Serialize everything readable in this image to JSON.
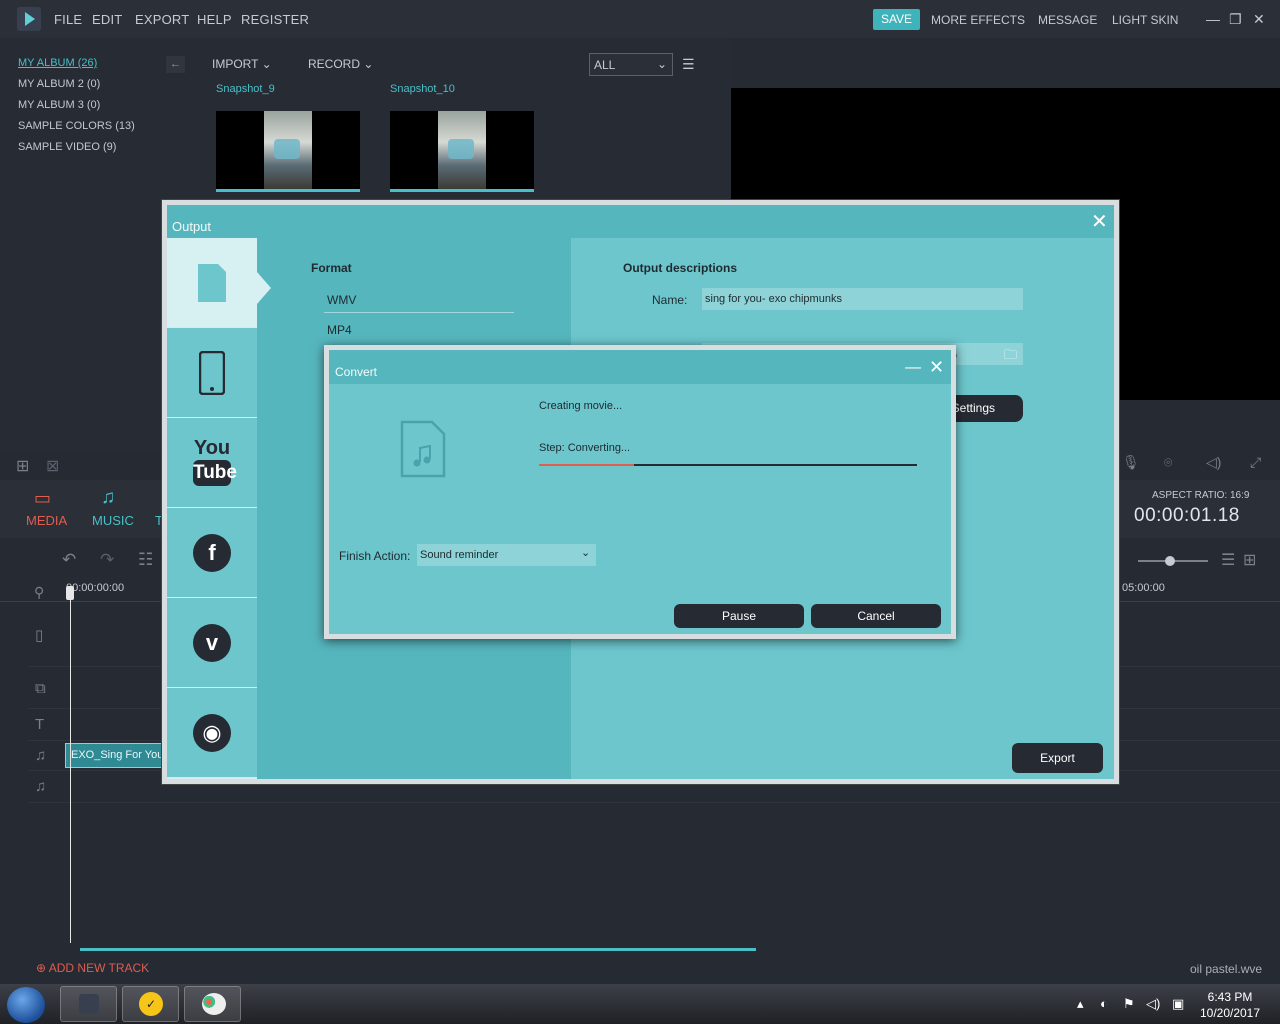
{
  "menubar": {
    "items": [
      "FILE",
      "EDIT",
      "EXPORT",
      "HELP",
      "REGISTER"
    ],
    "save": "SAVE",
    "right": [
      "MORE EFFECTS",
      "MESSAGE",
      "LIGHT SKIN"
    ],
    "window": {
      "minimize": "—",
      "maximize": "❐",
      "close": "✕"
    }
  },
  "albums": [
    "MY ALBUM (26)",
    "MY ALBUM 2 (0)",
    "MY ALBUM 3 (0)",
    "SAMPLE COLORS (13)",
    "SAMPLE VIDEO (9)"
  ],
  "media_toolbar": {
    "import": "IMPORT ⌄",
    "record": "RECORD ⌄",
    "filter": "ALL",
    "collapse": "←"
  },
  "thumbnails": [
    {
      "label": "Snapshot_9"
    },
    {
      "label": "Snapshot_10"
    }
  ],
  "tabs": {
    "media": "MEDIA",
    "music": "MUSIC",
    "third": "T"
  },
  "preview": {
    "aspect_ratio": "ASPECT RATIO: 16:9",
    "timecode": "00:00:01.18"
  },
  "timeline": {
    "ruler_start": "00:00:00:00",
    "ruler_end": "05:00:00",
    "audio_clip": "EXO_Sing For You",
    "add_track": "ADD NEW TRACK",
    "project_file": "oil pastel.wve"
  },
  "output": {
    "title": "Output",
    "close": "✕",
    "format_heading": "Format",
    "formats": [
      "WMV",
      "MP4"
    ],
    "desc_heading": "Output descriptions",
    "name_label": "Name:",
    "name_value": "sing for you- exo chipmunks",
    "path_value": "\\",
    "settings": "Settings",
    "export": "Export"
  },
  "convert": {
    "title": "Convert",
    "minimize": "—",
    "close": "✕",
    "status": "Creating movie...",
    "step": "Step: Converting...",
    "progress": 0.25,
    "finish_label": "Finish Action:",
    "finish_value": "Sound reminder",
    "pause": "Pause",
    "cancel": "Cancel"
  },
  "taskbar": {
    "time": "6:43 PM",
    "date": "10/20/2017"
  },
  "colors": {
    "accent": "#48c0c7",
    "red": "#e05d4f",
    "dialog": "#6cc6cc"
  }
}
